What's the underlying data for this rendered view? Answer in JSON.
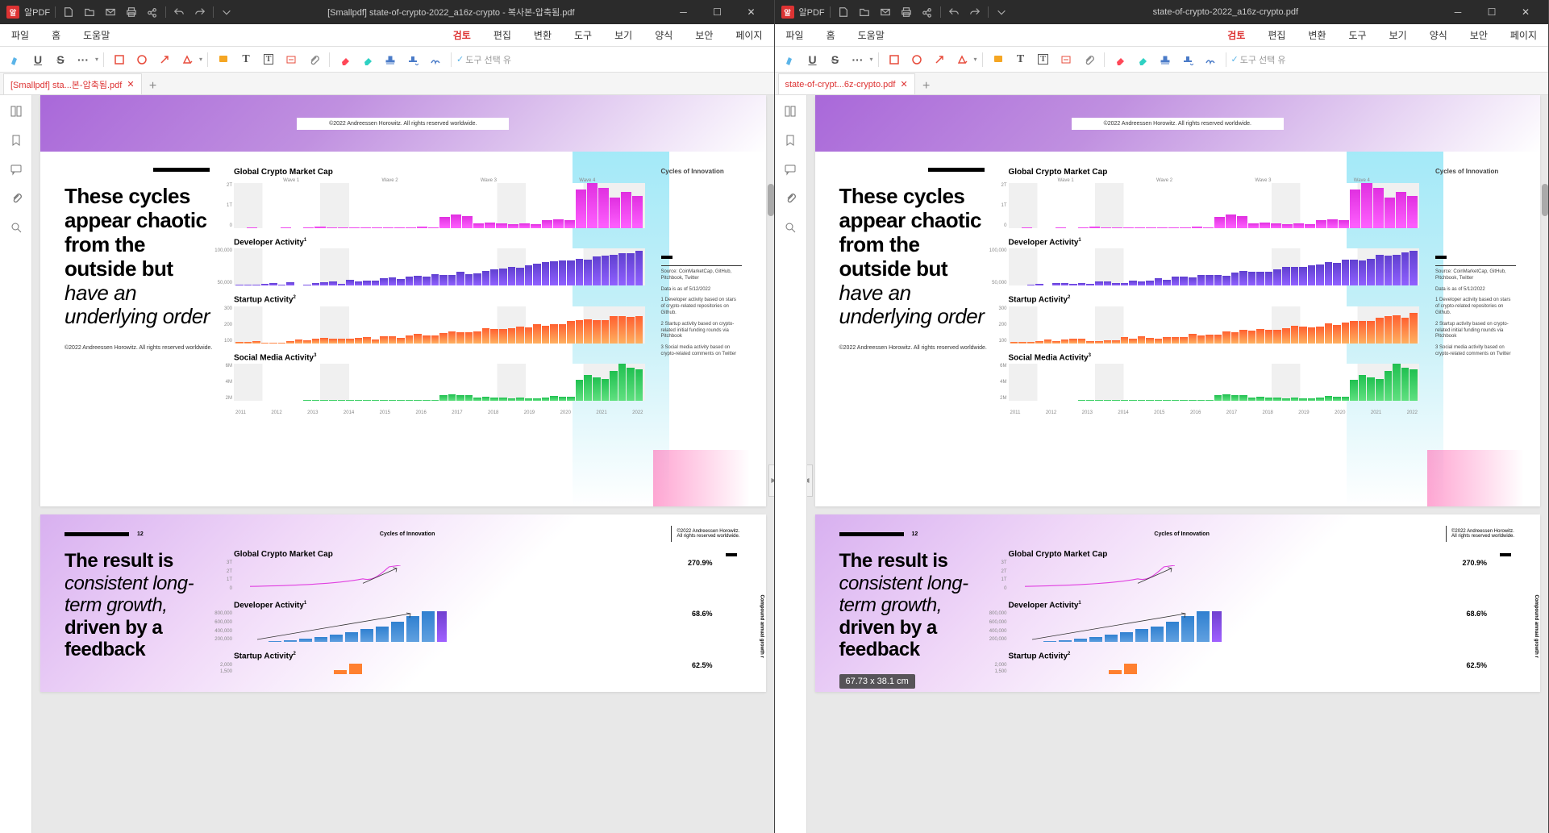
{
  "app_label": "알PDF",
  "windows": [
    {
      "title": "[Smallpdf] state-of-crypto-2022_a16z-crypto - 복사본-압축됨.pdf",
      "tab_name": "[Smallpdf] sta...본-압축됨.pdf"
    },
    {
      "title": "state-of-crypto-2022_a16z-crypto.pdf",
      "tab_name": "state-of-crypt...6z-crypto.pdf"
    }
  ],
  "menu": [
    "파일",
    "홈",
    "도움말",
    "검토",
    "편집",
    "변환",
    "도구",
    "보기",
    "양식",
    "보안",
    "페이지"
  ],
  "menu_active": "검토",
  "toolbar_hint": "도구 선택 유",
  "page1": {
    "copyright_top": "©2022 Andreessen Horowitz. All rights reserved worldwide.",
    "headline_bold": "These cycles appear chaotic from the outside but ",
    "headline_italic": "have an underlying order",
    "copyright_bottom": "©2022 Andreessen Horowitz. All rights reserved worldwide.",
    "info_title": "Cycles of Innovation",
    "info_source": "Source: CoinMarketCap, GitHub, Pitchbook, Twitter",
    "info_date": "Data is as of 5/12/2022",
    "info_note1": "1 Developer activity based on stars of crypto-related repositories on Github.",
    "info_note2": "2 Startup activity based on crypto-related initial funding rounds via Pitchbook",
    "info_note3": "3 Social media activity based on crypto-related comments on Twitter",
    "waves": [
      "Wave 1",
      "Wave 2",
      "Wave 3",
      "Wave 4"
    ],
    "years": [
      "2011",
      "2012",
      "2013",
      "2014",
      "2015",
      "2016",
      "2017",
      "2018",
      "2019",
      "2020",
      "2021",
      "2022"
    ],
    "c_marketcap": {
      "title": "Global Crypto Market Cap",
      "yticks": [
        "2T",
        "1T",
        "0"
      ]
    },
    "c_dev": {
      "title": "Developer Activity",
      "sup": "1",
      "yticks": [
        "100,000",
        "50,000"
      ]
    },
    "c_startup": {
      "title": "Startup Activity",
      "sup": "2",
      "yticks": [
        "300",
        "200",
        "100"
      ]
    },
    "c_social": {
      "title": "Social Media Activity",
      "sup": "3",
      "yticks": [
        "6M",
        "4M",
        "2M"
      ]
    }
  },
  "page2": {
    "num": "12",
    "label": "Cycles of Innovation",
    "copyright": "©2022 Andreessen Horowitz. All rights reserved worldwide.",
    "headline_1b": "The result is ",
    "headline_2i": "consistent long-term growth, ",
    "headline_3b": "driven by a feedback",
    "vert": "Compound annual growth r",
    "c1": {
      "title": "Global Crypto Market Cap",
      "pct": "270.9%",
      "yticks": [
        "3T",
        "2T",
        "1T",
        "0"
      ]
    },
    "c2": {
      "title": "Developer Activity",
      "sup": "1",
      "pct": "68.6%",
      "yticks": [
        "800,000",
        "600,000",
        "400,000",
        "200,000"
      ]
    },
    "c3": {
      "title": "Startup Activity",
      "sup": "2",
      "pct": "62.5%",
      "yticks": [
        "2,000",
        "1,500"
      ]
    }
  },
  "tooltip": "67.73 x 38.1 cm",
  "chart_data": [
    {
      "type": "bar",
      "title": "Global Crypto Market Cap",
      "x": [
        "2011",
        "2012",
        "2013",
        "2014",
        "2015",
        "2016",
        "2017",
        "2018",
        "2019",
        "2020",
        "2021",
        "2022"
      ],
      "waves": [
        "Wave 1",
        "Wave 2",
        "Wave 3",
        "Wave 4"
      ],
      "ylim": [
        0,
        2000000000000
      ],
      "yticks": [
        "0",
        "1T",
        "2T"
      ],
      "values_relative": [
        0.01,
        0.01,
        0.03,
        0.02,
        0.02,
        0.03,
        0.3,
        0.12,
        0.1,
        0.2,
        1.0,
        0.8
      ],
      "color": "magenta"
    },
    {
      "type": "bar",
      "title": "Developer Activity",
      "ylim": [
        0,
        100000
      ],
      "yticks": [
        "50,000",
        "100,000"
      ],
      "values_relative": [
        0.02,
        0.03,
        0.05,
        0.08,
        0.1,
        0.14,
        0.3,
        0.35,
        0.38,
        0.45,
        0.8,
        1.0
      ],
      "color": "purple"
    },
    {
      "type": "bar",
      "title": "Startup Activity",
      "ylim": [
        0,
        300
      ],
      "yticks": [
        "100",
        "200",
        "300"
      ],
      "values_relative": [
        0.05,
        0.08,
        0.18,
        0.22,
        0.2,
        0.22,
        0.4,
        0.55,
        0.4,
        0.45,
        0.85,
        0.6
      ],
      "color": "orange"
    },
    {
      "type": "bar",
      "title": "Social Media Activity",
      "ylim": [
        0,
        6000000
      ],
      "yticks": [
        "2M",
        "4M",
        "6M"
      ],
      "values_relative": [
        0.01,
        0.01,
        0.03,
        0.02,
        0.02,
        0.03,
        0.18,
        0.1,
        0.08,
        0.12,
        0.7,
        1.0
      ],
      "color": "green"
    },
    {
      "type": "line",
      "title": "Global Crypto Market Cap",
      "annotation": "270.9%",
      "ylim": [
        0,
        3000000000000
      ],
      "yticks": [
        "0",
        "1T",
        "2T",
        "3T"
      ]
    },
    {
      "type": "bar",
      "title": "Developer Activity",
      "annotation": "68.6%",
      "ylim": [
        0,
        800000
      ],
      "yticks": [
        "200,000",
        "400,000",
        "600,000",
        "800,000"
      ],
      "values_relative": [
        0.02,
        0.04,
        0.07,
        0.12,
        0.18,
        0.24,
        0.32,
        0.42,
        0.52,
        0.68,
        0.85,
        1.0
      ],
      "color": "blue"
    },
    {
      "type": "bar",
      "title": "Startup Activity",
      "annotation": "62.5%",
      "ylim": [
        0,
        2000
      ],
      "yticks": [
        "1,500",
        "2,000"
      ]
    }
  ]
}
